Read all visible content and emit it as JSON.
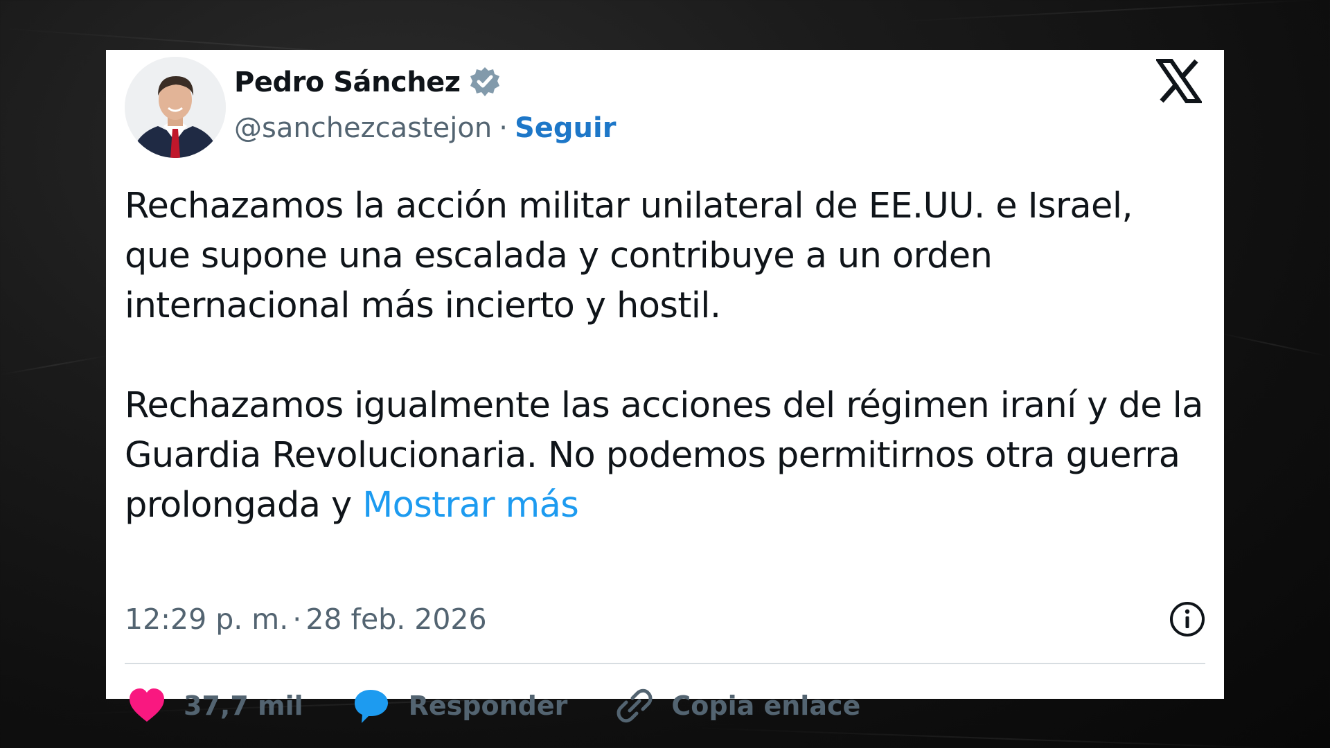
{
  "colors": {
    "page_background": "#141414",
    "card_background": "#ffffff",
    "text_primary": "#0f1419",
    "text_secondary": "#536471",
    "follow_link": "#1d77c8",
    "show_more_link": "#1d9bf0",
    "heart": "#f91880",
    "reply_bubble": "#1d9bf0",
    "verified_badge": "#829aab"
  },
  "icons": {
    "platform": "x-logo-icon",
    "verified": "verified-badge-icon",
    "info": "info-icon",
    "like": "heart-icon",
    "reply": "speech-bubble-icon",
    "copy_link": "link-icon"
  },
  "author": {
    "name": "Pedro Sánchez",
    "handle": "@sanchezcastejon",
    "separator": "·",
    "follow_label": "Seguir"
  },
  "tweet": {
    "paragraph_1": "Rechazamos la acción militar unilateral de EE.UU. e Israel, que supone una escalada y contribuye a un orden internacional más incierto y hostil.",
    "paragraph_2": "Rechazamos igualmente las acciones del régimen iraní y de la Guardia Revolucionaria. No podemos permitirnos otra guerra prolongada y",
    "show_more": "Mostrar más"
  },
  "meta": {
    "time": "12:29 p. m.",
    "separator": "·",
    "date": "28 feb. 2026"
  },
  "actions": {
    "likes": "37,7 mil",
    "reply_label": "Responder",
    "copy_link_label": "Copia enlace"
  }
}
